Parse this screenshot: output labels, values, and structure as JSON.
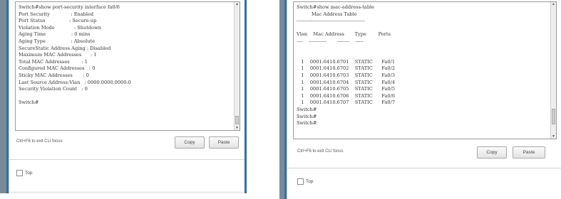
{
  "left_window": {
    "terminal_lines": [
      "Switch#show port-security interface fa0/6",
      "Port Security              : Enabled",
      "Port Status                : Secure-up",
      "Violation Mode             : Shutdown",
      "Aging Time                 : 0 mins",
      "Aging Type                 : Absolute",
      "SecureStatic Address Aging : Disabled",
      "Maximum MAC Addresses      : 1",
      "Total MAC Addresses        : 1",
      "Configured MAC Addresses   : 0",
      "Sticky MAC Addresses       : 0",
      "Last Source Address:Vlan   : 0000.0000.0000:0",
      "Security Violation Count   : 0",
      "",
      "Switch#"
    ],
    "hint_text": "Ctrl+F6 to exit CLI focus",
    "copy_label": "Copy",
    "paste_label": "Paste",
    "top_label": "Top"
  },
  "right_window": {
    "terminal_lines": [
      "Switch#show mac-address-table",
      "          Mac Address Table",
      "-------------------------------------------",
      "",
      "Vlan    Mac Address       Type        Ports",
      "----    -----------       --------    -----",
      "",
      "",
      "   1    0001.6410.6701    STATIC      Fa0/1",
      "   1    0001.6410.6702    STATIC      Fa0/2",
      "   1    0001.6410.6703    STATIC      Fa0/3",
      "   1    0001.6410.6704    STATIC      Fa0/4",
      "   1    0001.6410.6705    STATIC      Fa0/5",
      "   1    0001.6410.6706    STATIC      Fa0/6",
      "   1    0001.6410.6707    STATIC      Fa0/7",
      "Switch#",
      "Switch#",
      "Switch#"
    ],
    "hint_text": "Ctrl+F6 to exit CLI focus",
    "copy_label": "Copy",
    "paste_label": "Paste",
    "top_label": "Top"
  },
  "colors": {
    "accent_blue": "#2f6fb3",
    "frame_gray": "#7a8a99"
  }
}
